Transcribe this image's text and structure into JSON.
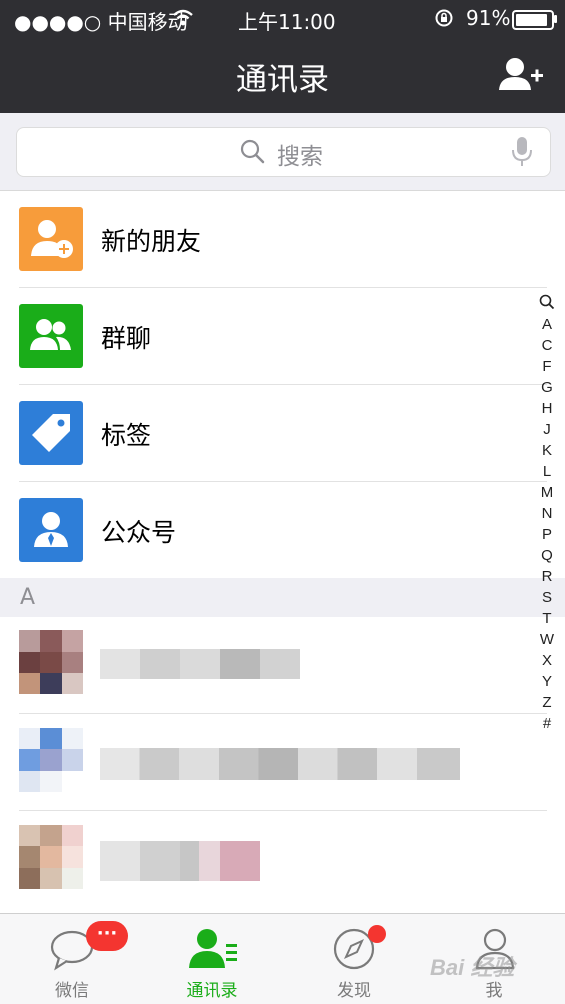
{
  "status_bar": {
    "carrier": "●●●●○ 中国移动",
    "time": "上午11:00",
    "battery": "91%"
  },
  "nav": {
    "title": "通讯录",
    "add_icon": "add-contact-icon"
  },
  "search": {
    "placeholder": "搜索"
  },
  "fixed_items": [
    {
      "label": "新的朋友",
      "icon": "new-friend-icon",
      "color": "#f79c3b"
    },
    {
      "label": "群聊",
      "icon": "group-chat-icon",
      "color": "#1aad19"
    },
    {
      "label": "标签",
      "icon": "tag-icon",
      "color": "#2e7ed8"
    },
    {
      "label": "公众号",
      "icon": "official-account-icon",
      "color": "#2e7ed8"
    }
  ],
  "section": {
    "label": "A"
  },
  "index": [
    "A",
    "C",
    "F",
    "G",
    "H",
    "J",
    "K",
    "L",
    "M",
    "N",
    "P",
    "Q",
    "R",
    "S",
    "T",
    "W",
    "X",
    "Y",
    "Z",
    "#"
  ],
  "tabs": [
    {
      "label": "微信",
      "badge": "···",
      "active": false
    },
    {
      "label": "通讯录",
      "active": true
    },
    {
      "label": "发现",
      "active": false
    },
    {
      "label": "我",
      "active": false
    }
  ],
  "watermark": "Bai 经验",
  "colors": {
    "active": "#1aad19",
    "badge": "#f43530",
    "nav_bg": "#2f2f33"
  }
}
